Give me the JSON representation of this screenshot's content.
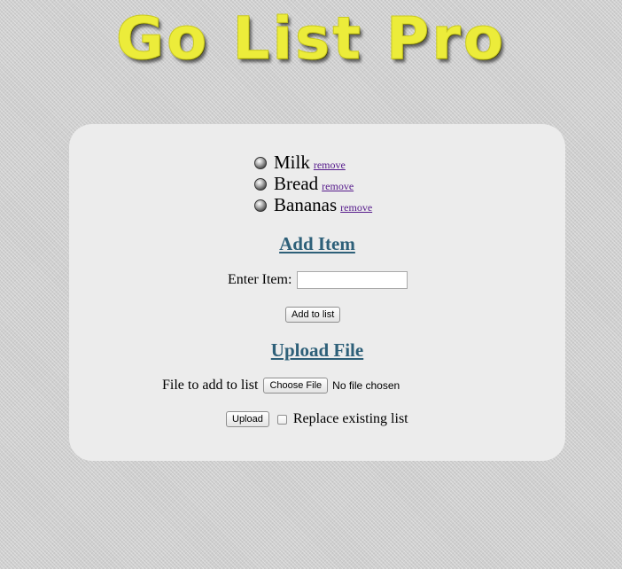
{
  "app": {
    "logo_text": "Go List Pro"
  },
  "list": {
    "items": [
      {
        "name": "Milk",
        "remove_label": "remove"
      },
      {
        "name": "Bread",
        "remove_label": "remove"
      },
      {
        "name": "Bananas",
        "remove_label": "remove"
      }
    ]
  },
  "add_item": {
    "title": "Add Item",
    "field_label": "Enter Item:",
    "input_value": "",
    "button_label": "Add to list"
  },
  "upload": {
    "title": "Upload File",
    "file_label": "File to add to list",
    "choose_button_label": "Choose File",
    "file_status": "No file chosen",
    "upload_button_label": "Upload",
    "replace_label": "Replace existing list",
    "replace_checked": false
  },
  "colors": {
    "logo": "#ecec3a",
    "section_title": "#2e6079",
    "link": "#551a8b",
    "panel": "#ececec"
  }
}
